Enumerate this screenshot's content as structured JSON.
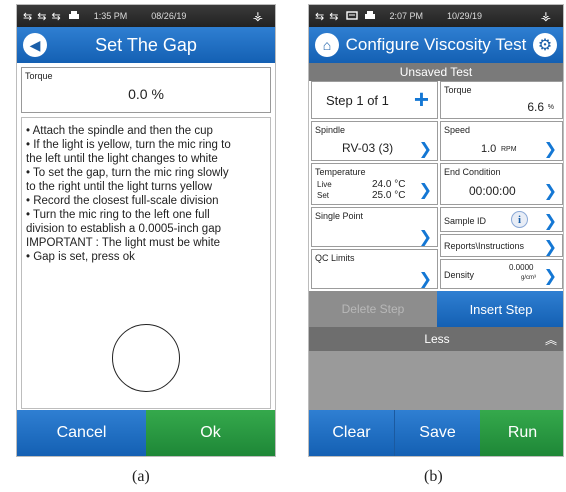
{
  "panel_a": {
    "status": {
      "usb_icons": "⇆ ⇆ ⇆",
      "printer_icon": "printer-icon",
      "time": "1:35 PM",
      "date": "08/26/19",
      "brand_icon": "brookfield-icon"
    },
    "title": "Set The Gap",
    "torque": {
      "label": "Torque",
      "value": "0.0 %"
    },
    "instructions": [
      "• Attach the spindle and then the cup",
      "• If the light is yellow, turn the mic ring to",
      "the left until the light changes to white",
      "• To set the gap, turn the mic ring slowly",
      "to the right until the light turns yellow",
      "• Record the closest full-scale division",
      "• Turn the mic ring to the left one full",
      "division to establish a 0.0005-inch gap",
      "IMPORTANT : The light must be white",
      "• Gap is set, press ok"
    ],
    "buttons": {
      "cancel": "Cancel",
      "ok": "Ok"
    },
    "caption": "(a)"
  },
  "panel_b": {
    "status": {
      "usb_icons": "⇆ ⇆",
      "time": "2:07 PM",
      "date": "10/29/19",
      "brand_icon": "brookfield-icon"
    },
    "title": "Configure Viscosity Test",
    "subtitle": "Unsaved Test",
    "step": {
      "label": "Step 1 of 1",
      "plus_icon": "plus-icon"
    },
    "torque": {
      "label": "Torque",
      "value": "6.6",
      "unit": "%"
    },
    "spindle": {
      "label": "Spindle",
      "value": "RV-03 (3)"
    },
    "speed": {
      "label": "Speed",
      "value": "1.0",
      "unit": "RPM"
    },
    "temperature": {
      "label": "Temperature",
      "live_label": "Live",
      "live_value": "24.0 °C",
      "set_label": "Set",
      "set_value": "25.0 °C"
    },
    "end_condition": {
      "label": "End Condition",
      "value": "00:00:00"
    },
    "single_point": {
      "label": "Single Point"
    },
    "sample_id": {
      "label": "Sample ID"
    },
    "reports": {
      "label": "Reports\\Instructions"
    },
    "qc_limits": {
      "label": "QC Limits"
    },
    "density": {
      "label": "Density",
      "value": "0.0000",
      "unit": "g/cm³"
    },
    "buttons": {
      "delete_step": "Delete Step",
      "insert_step": "Insert Step",
      "less": "Less",
      "clear": "Clear",
      "save": "Save",
      "run": "Run"
    },
    "caption": "(b)"
  },
  "colors": {
    "blue": "#1b6ec2",
    "green": "#2a9a45",
    "gray": "#7a7a7a"
  }
}
